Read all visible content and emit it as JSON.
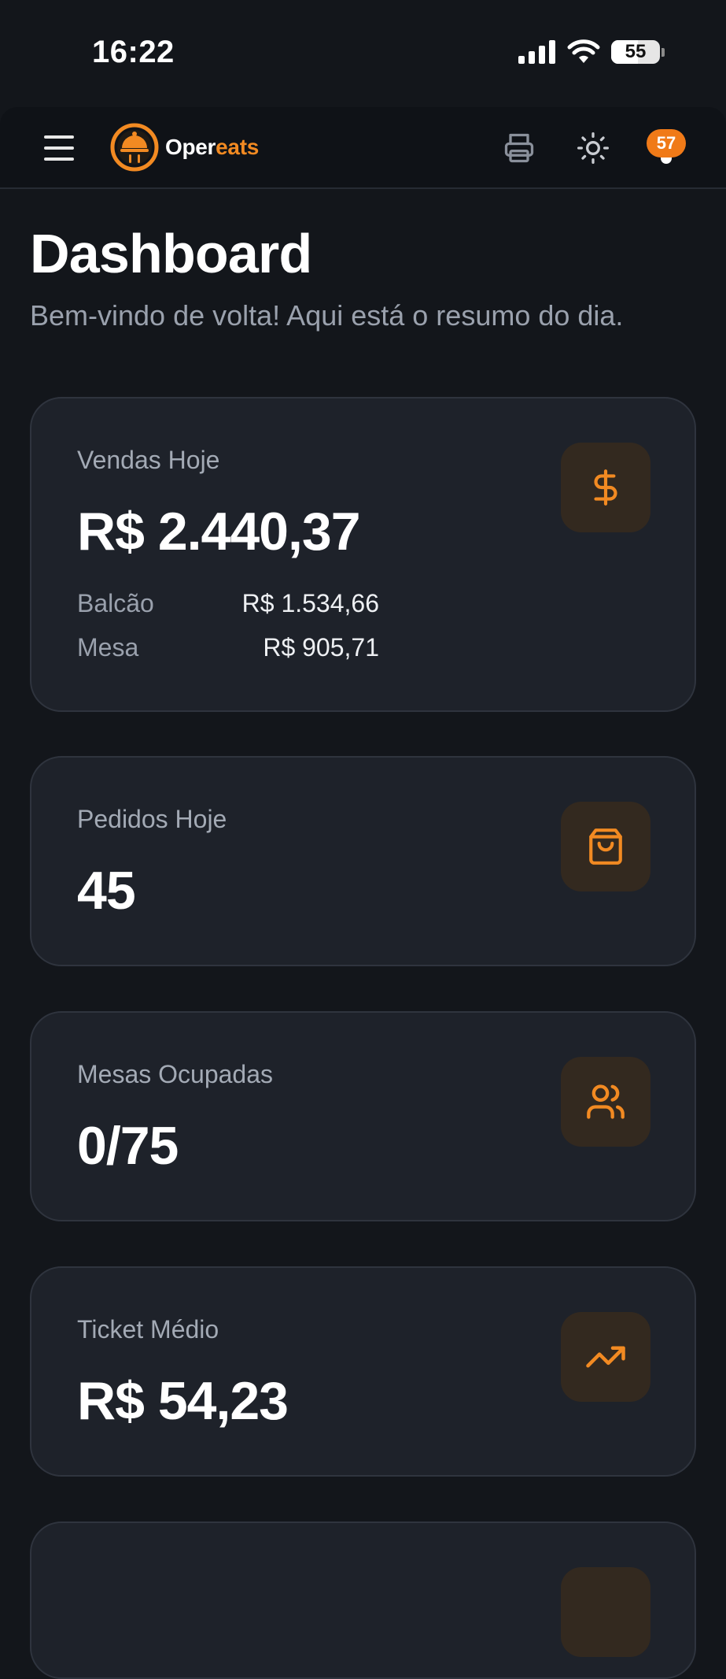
{
  "status_bar": {
    "time": "16:22",
    "battery": "55",
    "battery_level": 0.55
  },
  "header": {
    "brand_part1": "Oper",
    "brand_part2": "eats",
    "notification_count": "57"
  },
  "page": {
    "title": "Dashboard",
    "subtitle": "Bem-vindo de volta! Aqui está o resumo do dia."
  },
  "cards": [
    {
      "label": "Vendas Hoje",
      "value": "R$ 2.440,37",
      "icon": "dollar-icon",
      "breakdown": [
        {
          "label": "Balcão",
          "value": "R$ 1.534,66"
        },
        {
          "label": "Mesa",
          "value": "R$ 905,71"
        }
      ]
    },
    {
      "label": "Pedidos Hoje",
      "value": "45",
      "icon": "shopping-bag-icon"
    },
    {
      "label": "Mesas Ocupadas",
      "value": "0/75",
      "icon": "users-icon"
    },
    {
      "label": "Ticket Médio",
      "value": "R$ 54,23",
      "icon": "trending-up-icon"
    }
  ],
  "colors": {
    "accent": "#f28a22",
    "background": "#13161b",
    "card": "#1e222a",
    "icon_box": "#33291f",
    "badge": "#f07a18"
  }
}
